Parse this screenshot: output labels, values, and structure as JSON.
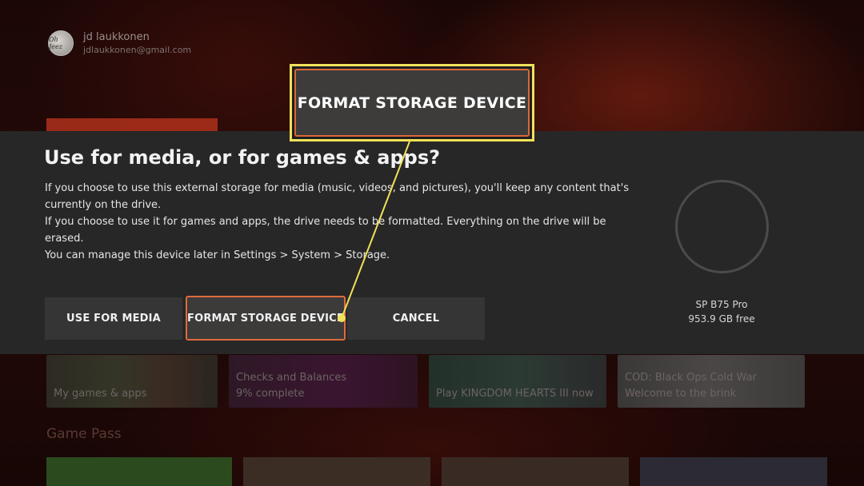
{
  "profile": {
    "avatar_text": "Oh Jeez",
    "name": "jd laukkonen",
    "email": "jdlaukkonen@gmail.com"
  },
  "background": {
    "tiles": [
      {
        "line1": "My games & apps",
        "line2": ""
      },
      {
        "line1": "Checks and Balances",
        "line2": "9% complete"
      },
      {
        "line1": "Play KINGDOM HEARTS III now",
        "line2": ""
      },
      {
        "line1": "COD: Black Ops Cold War",
        "line2": "Welcome to the brink"
      }
    ],
    "section_title": "Game Pass"
  },
  "dialog": {
    "title": "Use for media, or for games & apps?",
    "body": [
      "If you choose to use this external storage for media (music, videos, and pictures), you'll keep any content that's currently on the drive.",
      "If you choose to use it for games and apps, the drive needs to be formatted. Everything on the drive will be erased.",
      "You can manage this device later in Settings > System > Storage."
    ],
    "buttons": {
      "use_for_media": "USE FOR MEDIA",
      "format": "FORMAT STORAGE DEVICE",
      "cancel": "CANCEL"
    },
    "storage": {
      "name": "SP B75 Pro",
      "free": "953.9 GB free"
    }
  },
  "callout": {
    "label": "FORMAT STORAGE DEVICE",
    "highlight_color": "#f1e15a",
    "focus_color": "#e06a3c"
  }
}
